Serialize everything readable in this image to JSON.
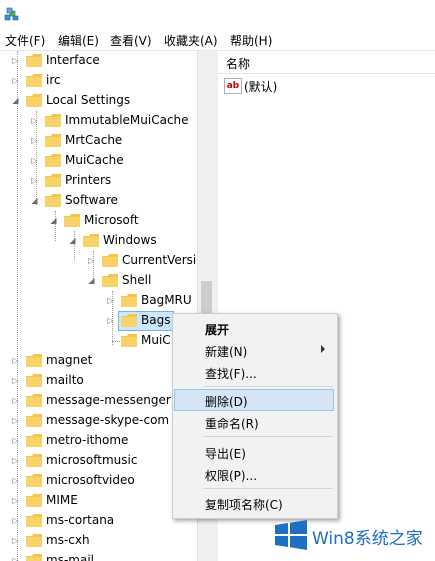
{
  "menubar": {
    "items": [
      "文件(F)",
      "编辑(E)",
      "查看(V)",
      "收藏夹(A)",
      "帮助(H)"
    ]
  },
  "tree": {
    "items": [
      {
        "label": "Interface",
        "toggle": "▷"
      },
      {
        "label": "irc",
        "toggle": "▷"
      },
      {
        "label": "Local Settings",
        "toggle": "◢"
      },
      {
        "label": "ImmutableMuiCache",
        "toggle": "▷"
      },
      {
        "label": "MrtCache",
        "toggle": "▷"
      },
      {
        "label": "MuiCache",
        "toggle": "▷"
      },
      {
        "label": "Printers",
        "toggle": "▷"
      },
      {
        "label": "Software",
        "toggle": "◢"
      },
      {
        "label": "Microsoft",
        "toggle": "◢"
      },
      {
        "label": "Windows",
        "toggle": "◢"
      },
      {
        "label": "CurrentVersio",
        "toggle": "▷"
      },
      {
        "label": "Shell",
        "toggle": "◢"
      },
      {
        "label": "BagMRU",
        "toggle": "▷"
      },
      {
        "label": "Bags",
        "toggle": "▷"
      },
      {
        "label": "MuiC",
        "toggle": ""
      },
      {
        "label": "magnet",
        "toggle": "▷"
      },
      {
        "label": "mailto",
        "toggle": "▷"
      },
      {
        "label": "message-messenger",
        "toggle": "▷"
      },
      {
        "label": "message-skype-com",
        "toggle": "▷"
      },
      {
        "label": "metro-ithome",
        "toggle": "▷"
      },
      {
        "label": "microsoftmusic",
        "toggle": "▷"
      },
      {
        "label": "microsoftvideo",
        "toggle": "▷"
      },
      {
        "label": "MIME",
        "toggle": "▷"
      },
      {
        "label": "ms-cortana",
        "toggle": "▷"
      },
      {
        "label": "ms-cxh",
        "toggle": "▷"
      },
      {
        "label": "ms-mail",
        "toggle": "▷"
      }
    ]
  },
  "values": {
    "column_name": "名称",
    "rows": [
      {
        "icon": "ab",
        "name": "(默认)"
      }
    ]
  },
  "context_menu": {
    "items": [
      "展开",
      "新建(N)",
      "查找(F)...",
      "删除(D)",
      "重命名(R)",
      "导出(E)",
      "权限(P)...",
      "复制项名称(C)"
    ],
    "highlighted": "删除(D)"
  },
  "watermark": {
    "text": "Win8系统之家"
  },
  "colors": {
    "folder": "#f5c64b",
    "highlight": "#d4e6f6",
    "watermark": "#1f6fc5"
  }
}
